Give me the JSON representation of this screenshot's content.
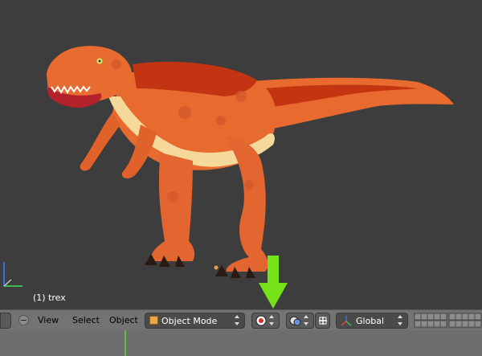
{
  "viewport": {
    "object_label": "(1) trex"
  },
  "header": {
    "menu": {
      "view": "View",
      "select": "Select",
      "object": "Object"
    },
    "mode_select": {
      "value": "Object Mode",
      "icon": "object-cube-icon"
    },
    "viewport_shading": {
      "icon": "shading-sphere-icon"
    },
    "pivot_point": {
      "icon": "pivot-point-icon"
    },
    "transform_orientation": {
      "value": "Global",
      "icon": "manipulator-icon"
    },
    "layers": {
      "icon": "layers-grid-icon"
    }
  },
  "timeline": {
    "playhead_color": "#57c241"
  },
  "annotation": {
    "arrow_color": "#76e21a",
    "arrow_icon": "green-down-arrow-icon"
  }
}
